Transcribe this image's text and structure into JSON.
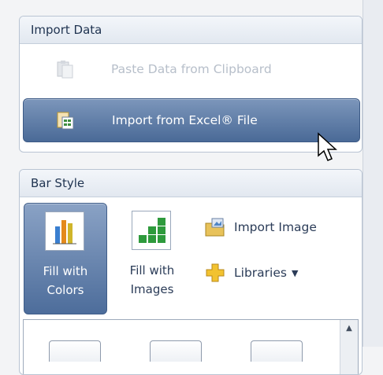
{
  "import_panel": {
    "title": "Import Data",
    "paste_label": "Paste Data from Clipboard",
    "excel_label": "Import from Excel® File",
    "paste_icon": "clipboard-paste-icon",
    "excel_icon": "excel-import-icon"
  },
  "bar_panel": {
    "title": "Bar Style",
    "fill_colors_line1": "Fill with",
    "fill_colors_line2": "Colors",
    "fill_images_line1": "Fill with",
    "fill_images_line2": "Images",
    "import_image_label": "Import Image",
    "libraries_label": "Libraries",
    "caret": "▼",
    "scroll_up": "▲",
    "icons": {
      "fill_colors": "bar-colors-icon",
      "fill_images": "bar-images-icon",
      "import_image": "folder-image-icon",
      "libraries": "plus-puzzle-icon"
    }
  },
  "colors": {
    "selected_gradient_top": "#8aa2c5",
    "selected_gradient_bottom": "#4d6d9b",
    "disabled_text": "#b7bfca"
  }
}
